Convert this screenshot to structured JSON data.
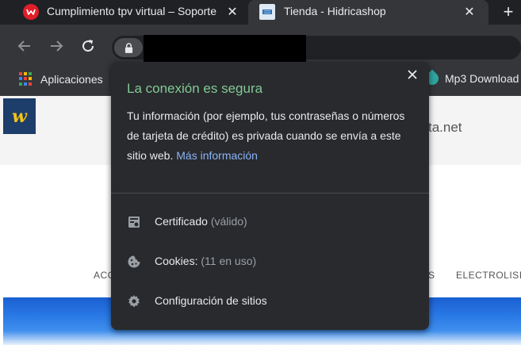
{
  "tabs": [
    {
      "title": "Cumplimiento tpv virtual – Soporte",
      "active": false,
      "close_label": "✕"
    },
    {
      "title": "Tienda - Hidricashop",
      "active": true,
      "close_label": "✕"
    }
  ],
  "new_tab_label": "+",
  "toolbar": {
    "back_icon": "arrow-left-icon",
    "forward_icon": "arrow-right-icon",
    "reload_icon": "reload-icon",
    "lock_icon": "lock-icon"
  },
  "bookmarks": {
    "apps_label": "Aplicaciones",
    "mp3_label": "Mp3 Download"
  },
  "page": {
    "logo_text": "w",
    "header_domain": "ta.net",
    "menu_left": "ACC",
    "menu_mid": "S",
    "menu_right": "ELECTROLISIS"
  },
  "popup": {
    "close_label": "✕",
    "title": "La conexión es segura",
    "body": "Tu información (por ejemplo, tus contraseñas o números de tarjeta de crédito) es privada cuando se envía a este sitio web.",
    "link": "Más información",
    "rows": [
      {
        "label": "Certificado",
        "sub": "(válido)",
        "icon": "certificate-icon"
      },
      {
        "label": "Cookies:",
        "sub": "(11 en uso)",
        "icon": "cookie-icon"
      },
      {
        "label": "Configuración de sitios",
        "sub": "",
        "icon": "gear-icon"
      }
    ]
  },
  "colors": {
    "secure_green": "#81c995",
    "link_blue": "#8ab4f8",
    "popup_bg": "#292a2d",
    "toolbar_bg": "#35363a"
  }
}
